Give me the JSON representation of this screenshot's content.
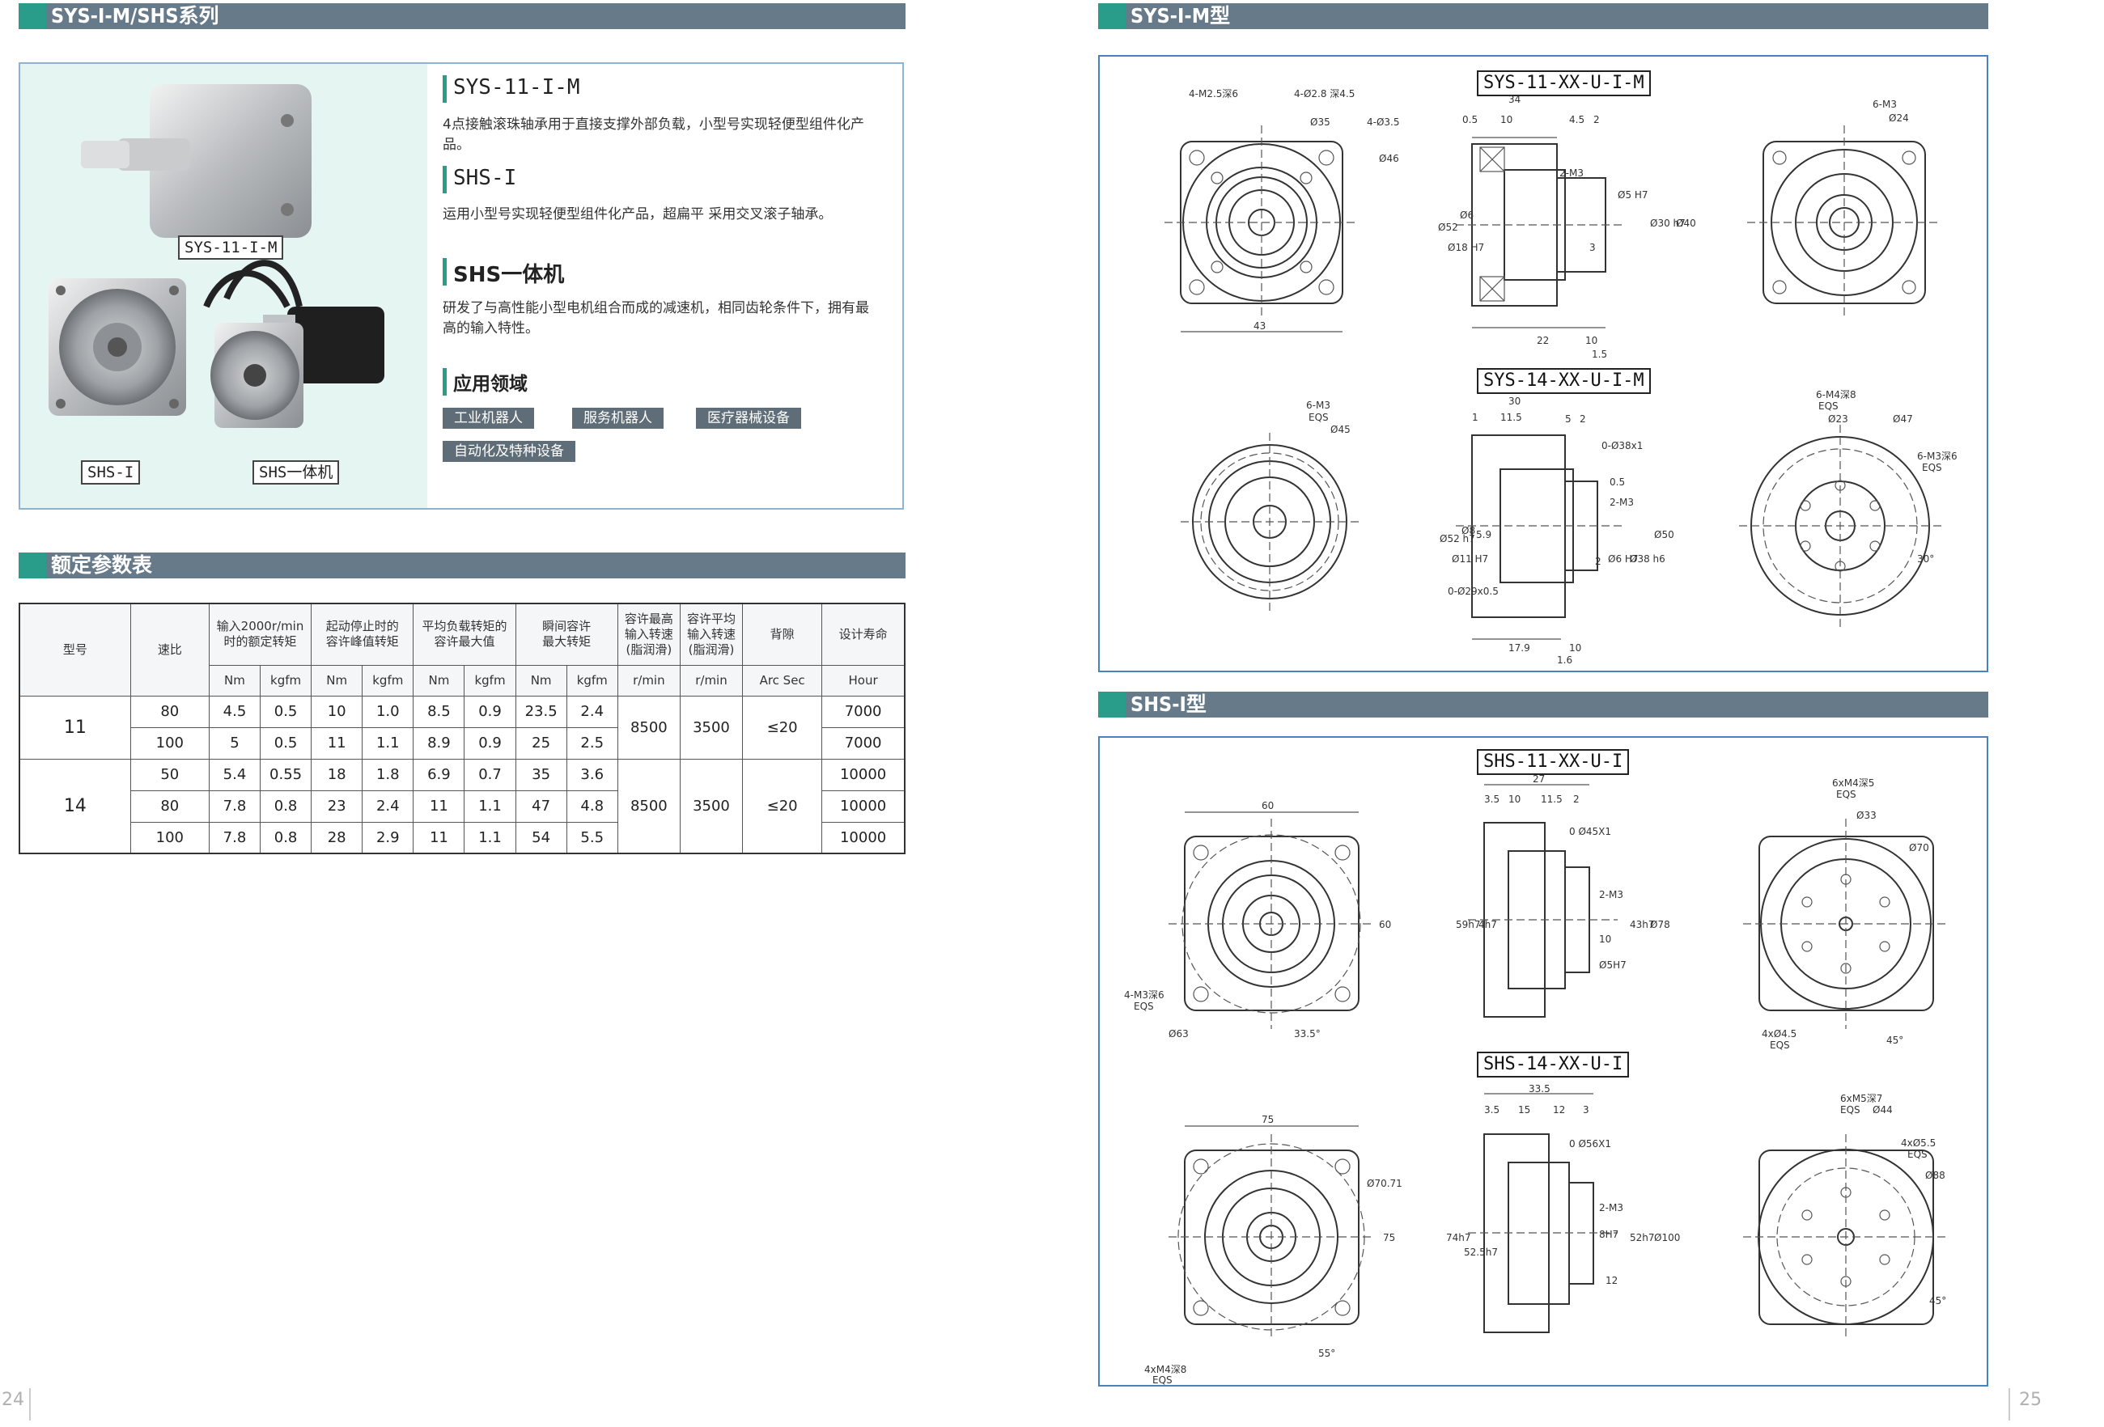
{
  "left_page": {
    "section_title": "SYS-I-M/SHS系列",
    "photo_labels": [
      "SYS-11-I-M",
      "SHS-I",
      "SHS一体机"
    ],
    "products": [
      {
        "name": "SYS-11-I-M",
        "desc": "4点接触滚珠轴承用于直接支撑外部负载，小型号实现轻便型组件化产品。"
      },
      {
        "name": "SHS-I",
        "desc": "运用小型号实现轻便型组件化产品，超扁平 采用交叉滚子轴承。"
      },
      {
        "name": "SHS一体机",
        "desc": "研发了与高性能小型电机组合而成的减速机，相同齿轮条件下，拥有最高的输入特性。"
      }
    ],
    "app_title": "应用领域",
    "app_tags": [
      "工业机器人",
      "服务机器人",
      "医疗器械设备",
      "自动化及特种设备"
    ],
    "table_title": "额定参数表",
    "table": {
      "headers": {
        "model": "型号",
        "ratio": "速比",
        "rated_torque": "输入2000r/min 时的额定转矩",
        "peak_torque": "起动停止时的 容许峰值转矩",
        "avg_torque": "平均负载转矩的 容许最大值",
        "momentary_torque": "瞬间容许 最大转矩",
        "max_speed": "容许最高 输入转速 (脂润滑)",
        "avg_speed": "容许平均 输入转速 (脂润滑)",
        "backlash": "背隙",
        "life": "设计寿命"
      },
      "units": [
        "Nm",
        "kgfm",
        "Nm",
        "kgfm",
        "Nm",
        "kgfm",
        "Nm",
        "kgfm",
        "r/min",
        "r/min",
        "Arc Sec",
        "Hour"
      ],
      "groups": [
        {
          "model": "11",
          "max_speed": "8500",
          "avg_speed": "3500",
          "backlash": "≤20",
          "rows": [
            [
              "80",
              "4.5",
              "0.5",
              "10",
              "1.0",
              "8.5",
              "0.9",
              "23.5",
              "2.4",
              "7000"
            ],
            [
              "100",
              "5",
              "0.5",
              "11",
              "1.1",
              "8.9",
              "0.9",
              "25",
              "2.5",
              "7000"
            ]
          ]
        },
        {
          "model": "14",
          "max_speed": "8500",
          "avg_speed": "3500",
          "backlash": "≤20",
          "rows": [
            [
              "50",
              "5.4",
              "0.55",
              "18",
              "1.8",
              "6.9",
              "0.7",
              "35",
              "3.6",
              "10000"
            ],
            [
              "80",
              "7.8",
              "0.8",
              "23",
              "2.4",
              "11",
              "1.1",
              "47",
              "4.8",
              "10000"
            ],
            [
              "100",
              "7.8",
              "0.8",
              "28",
              "2.9",
              "11",
              "1.1",
              "54",
              "5.5",
              "10000"
            ]
          ]
        }
      ]
    },
    "page_number": "24"
  },
  "right_page": {
    "section1_title": "SYS-I-M型",
    "section2_title": "SHS-I型",
    "drawing_titles": [
      "SYS-11-XX-U-I-M",
      "SYS-14-XX-U-I-M",
      "SHS-11-XX-U-I",
      "SHS-14-XX-U-I"
    ],
    "dims": {
      "d1": [
        "4-M2.5深6",
        "4-Ø2.8 深4.5",
        "Ø35",
        "4-Ø3.5",
        "Ø46",
        "43",
        "34",
        "0.5",
        "10",
        "4.5",
        "2",
        "2-M3",
        "Ø5 H7",
        "Ø30 h7",
        "Ø40",
        "Ø52",
        "Ø18 H7",
        "Ø6",
        "3",
        "22",
        "10",
        "1.5",
        "6-M3",
        "Ø24"
      ],
      "d2": [
        "6-M3",
        "EQS",
        "Ø45",
        "30",
        "11.5",
        "5",
        "2",
        "1",
        "0-Ø38x1",
        "0.5",
        "2-M3",
        "Ø52 h7",
        "Ø11 H7",
        "Ø8",
        "5.9",
        "Ø6 H7",
        "Ø38 h6",
        "Ø50",
        "2",
        "0-Ø29x0.5",
        "17.9",
        "10",
        "1.6",
        "6-M4深8",
        "EQS",
        "Ø23",
        "Ø47",
        "6-M3深6",
        "EQS",
        "30°"
      ],
      "d3": [
        "60",
        "60",
        "4-M3深6",
        "EQS",
        "Ø63",
        "33.5°",
        "27",
        "3.5",
        "10",
        "11.5",
        "2",
        "0 Ø45X1",
        "2-M3",
        "59h7",
        "4h7",
        "43h7",
        "Ø78",
        "10",
        "Ø5H7",
        "6xM4深5",
        "EQS",
        "Ø33",
        "Ø70",
        "4xØ4.5",
        "EQS",
        "45°"
      ],
      "d4": [
        "75",
        "75",
        "Ø70.71",
        "4xM4深8",
        "EQS",
        "55°",
        "33.5",
        "3.5",
        "15",
        "12",
        "3",
        "0 Ø56X1",
        "2-M3",
        "74h7",
        "52.5h7",
        "8H7",
        "52h7",
        "Ø100",
        "12",
        "6xM5深7",
        "EQS",
        "Ø44",
        "4xØ5.5",
        "EQS",
        "Ø88",
        "45°"
      ]
    },
    "page_number": "25"
  },
  "colors": {
    "bar": "#667a8a",
    "accent": "#2a9c8a",
    "panel_border": "#4a82c0",
    "photo_bg": "#e5f5f2",
    "tag_bg": "#5e6d77"
  }
}
